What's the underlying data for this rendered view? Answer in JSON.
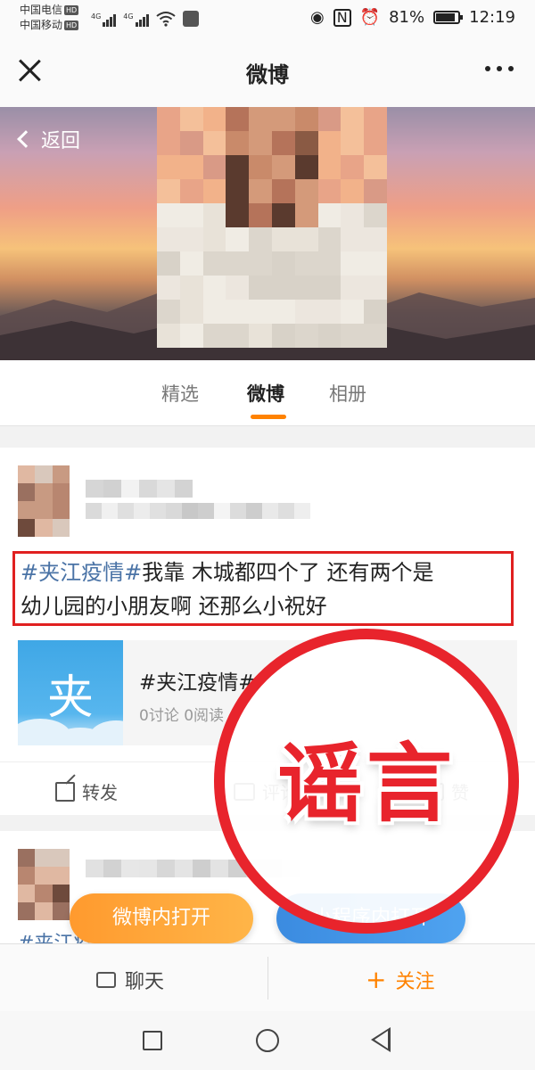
{
  "status_bar": {
    "carrier1": "中国电信",
    "carrier2": "中国移动",
    "hd": "HD",
    "net1": "4G",
    "net2": "4G",
    "battery": "81%",
    "time": "12:19"
  },
  "nav": {
    "title": "微博",
    "close_icon": "close-icon",
    "more_icon": "more-icon"
  },
  "cover": {
    "back_label": "返回"
  },
  "tabs": [
    {
      "label": "精选",
      "active": false
    },
    {
      "label": "微博",
      "active": true
    },
    {
      "label": "相册",
      "active": false
    }
  ],
  "post": {
    "hashtag": "#夹江疫情#",
    "text_line1": "我靠 木城都四个了 还有两个是",
    "text_line2": "幼儿园的小朋友啊 还那么小祝好",
    "link_card": {
      "thumb_char": "夹",
      "title": "#夹江疫情#",
      "stats": "0讨论 0阅读"
    },
    "actions": {
      "share": "转发",
      "comment": "评论",
      "like": "赞"
    }
  },
  "second_post": {
    "peek_text": "#夹江疫情#",
    "open_in_weibo": "微博内打开",
    "open_in_mini": "小程序内打开"
  },
  "bottom_bar": {
    "chat": "聊天",
    "follow_plus": "+",
    "follow": "关注"
  },
  "stamp": {
    "text": "谣言",
    "color": "#e8242c"
  },
  "colors": {
    "accent": "#ff8200",
    "hashtag": "#4a73a6",
    "highlight_border": "#e02020"
  }
}
